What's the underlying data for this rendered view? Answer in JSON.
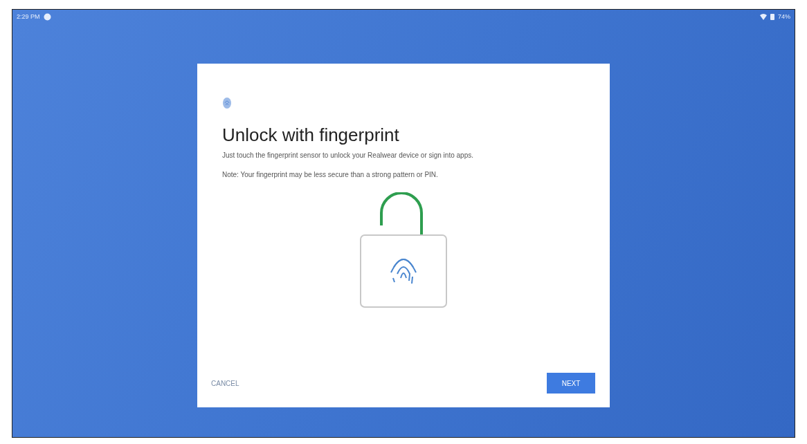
{
  "status_bar": {
    "time": "2:29 PM",
    "battery": "74%"
  },
  "dialog": {
    "title": "Unlock with fingerprint",
    "description": "Just touch the fingerprint sensor to unlock your Realwear device or sign into apps.",
    "note": "Note: Your fingerprint may be less secure than a strong pattern or PIN.",
    "buttons": [
      {
        "label": "CANCEL",
        "kind": "text"
      },
      {
        "label": "NEXT",
        "kind": "primary"
      }
    ]
  }
}
